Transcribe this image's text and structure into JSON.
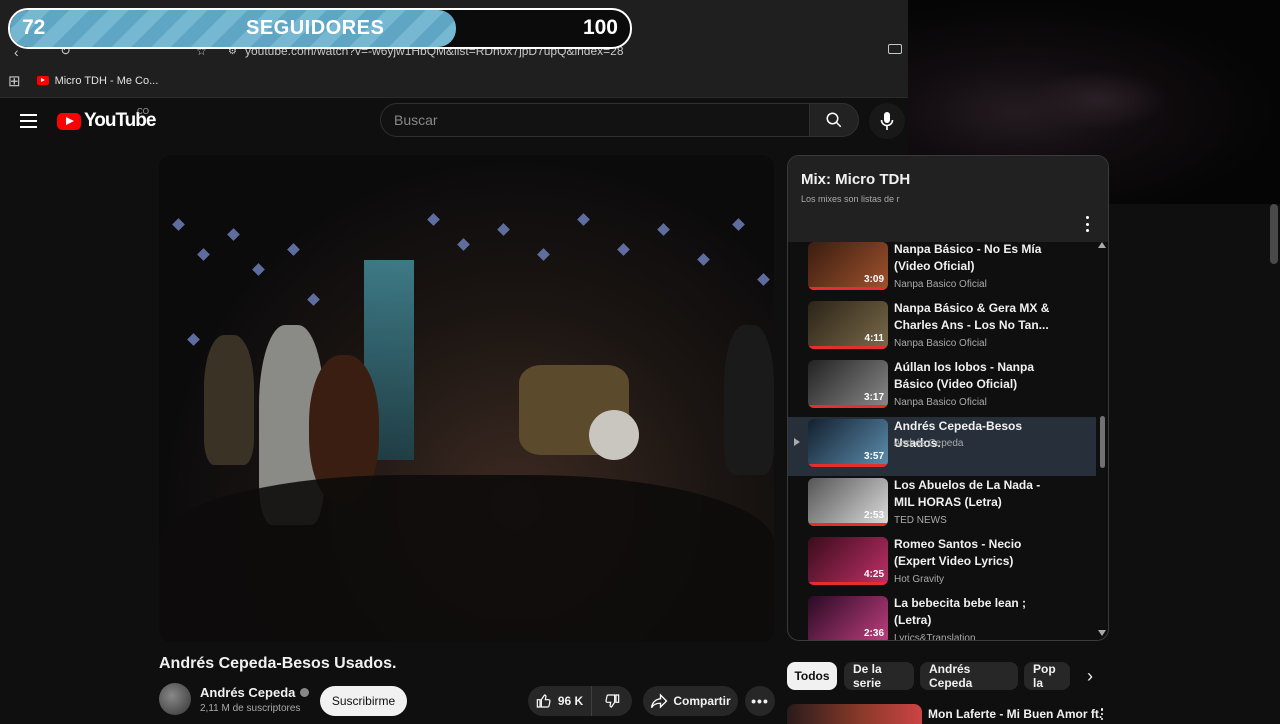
{
  "browser": {
    "url": "youtube.com/watch?v=-w6yjw1HbQM&list=RDh0x7jpD7upQ&index=28",
    "bookmarks": [
      {
        "label": "Micro TDH - Me Co..."
      }
    ]
  },
  "followers_overlay": {
    "current": "72",
    "label": "SEGUIDORES",
    "goal": "100",
    "progress_fraction": 0.72
  },
  "header": {
    "logo_text": "YouTube",
    "country_code": "CO",
    "search_placeholder": "Buscar"
  },
  "video": {
    "title": "Andrés Cepeda-Besos Usados.",
    "channel": "Andrés Cepeda",
    "subscribers": "2,11 M de suscriptores",
    "subscribe_label": "Suscribirme",
    "likes": "96 K",
    "share_label": "Compartir"
  },
  "playlist": {
    "title": "Mix: Micro TDH",
    "subtitle": "Los mixes son listas de r",
    "items": [
      {
        "title": "Nanpa Básico - No Es Mía (Video Oficial)",
        "channel": "Nanpa Basico Oficial",
        "duration": "3:09",
        "active": false,
        "thumb_colors": [
          "#3a1d10",
          "#a0522d"
        ]
      },
      {
        "title": "Nanpa Básico & Gera MX & Charles Ans - Los No Tan...",
        "channel": "Nanpa Basico Oficial",
        "duration": "4:11",
        "active": false,
        "thumb_colors": [
          "#2b2417",
          "#7a6a4b"
        ]
      },
      {
        "title": "Aúllan los lobos - Nanpa Básico (Video Oficial)",
        "channel": "Nanpa Basico Oficial",
        "duration": "3:17",
        "active": false,
        "thumb_colors": [
          "#222",
          "#8a8a8a"
        ]
      },
      {
        "title": "Andrés Cepeda-Besos Usados.",
        "channel": "Andrés Cepeda",
        "duration": "3:57",
        "active": true,
        "thumb_colors": [
          "#13202e",
          "#5d8fb0"
        ]
      },
      {
        "title": "Los Abuelos de La Nada - MIL HORAS (Letra)",
        "channel": "TED NEWS",
        "duration": "2:53",
        "active": false,
        "thumb_colors": [
          "#555",
          "#ddd"
        ]
      },
      {
        "title": "Romeo Santos - Necio (Expert Video Lyrics)",
        "channel": "Hot Gravity",
        "duration": "4:25",
        "active": false,
        "thumb_colors": [
          "#3a0c1a",
          "#c0306a"
        ]
      },
      {
        "title": "La bebecita bebe lean ; (Letra)",
        "channel": "Lyrics&Translation",
        "duration": "2:36",
        "active": false,
        "thumb_colors": [
          "#2a0a24",
          "#c04080"
        ]
      }
    ]
  },
  "chips": [
    {
      "label": "Todos",
      "active": true
    },
    {
      "label": "De la serie",
      "active": false
    },
    {
      "label": "Andrés Cepeda",
      "active": false
    },
    {
      "label": "Pop la",
      "active": false
    }
  ],
  "next_video": {
    "title": "Mon Laferte - Mi Buen Amor ft."
  },
  "colors": {
    "accent": "#ff0000",
    "background": "#0f0f0f",
    "progress_fill": "#6fb2cd"
  }
}
